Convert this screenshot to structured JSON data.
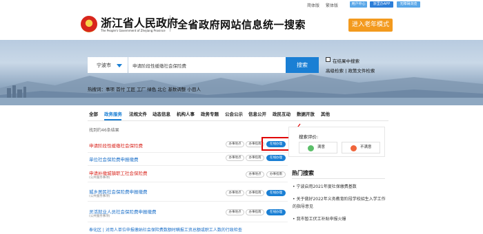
{
  "topbar": {
    "simplified": "简体版",
    "traditional": "繁体版",
    "user_center": "用户中心",
    "app": "浙里办APP",
    "accessible": "无障碍浏览"
  },
  "header": {
    "logo_cn": "浙江省人民政府",
    "logo_en": "The People's Government of Zhejiang Province",
    "slogan": "全省政府网站信息统一搜索",
    "elder_mode": "进入老年模式"
  },
  "search": {
    "region": "宁波市",
    "query": "申请阶段性缓缴社会保险费",
    "button": "搜索",
    "in_results": "在结果中搜索",
    "advanced": "高级检索 | 政策文件检索",
    "hot_words": "热搜词：事项 首付 工匠 工厂 绿色 北仑 基数调整 小目人"
  },
  "tabs": [
    "全部",
    "政务服务",
    "法规文件",
    "动态信息",
    "机构人事",
    "政务专题",
    "公会公示",
    "信息公开",
    "政民互动",
    "数据开放",
    "其他"
  ],
  "active_tab": "政务服务",
  "result_count": "找到约46条结果",
  "results": [
    {
      "title": "申请阶段性缓缴社会保险费",
      "color": "#d9251d",
      "sub": "",
      "buttons": [
        "办事地点",
        "办事指南"
      ],
      "online": "在线办理"
    },
    {
      "title": "单位社会保险费申报缴费",
      "color": "#1a6fc9",
      "sub": "",
      "buttons": [
        "办事地点",
        "办事指南"
      ],
      "online": "在线办理"
    },
    {
      "title": "申请补缴城镇职工社会保险费",
      "color": "#d9251d",
      "sub": "(公共服务事项)",
      "buttons": [
        "办事地点",
        "办事指南"
      ],
      "online": ""
    },
    {
      "title": "城乡居民社会保险费申报缴费",
      "color": "#1a6fc9",
      "sub": "(公共服务事项)",
      "buttons": [
        "办事地点",
        "办事指南"
      ],
      "online": "在线办理"
    },
    {
      "title": "灵活就业人员社会保险费申报缴费",
      "color": "#1a6fc9",
      "sub": "(公共服务事项)",
      "buttons": [
        "办事地点",
        "办事指南"
      ],
      "online": "在线办理"
    },
    {
      "title": "奉化区 | 对用人单位申报缴纳社会保险费数额时瞒报工资总额或职工人数的行政检查",
      "color": "#1a6fc9",
      "sub": "",
      "buttons": [],
      "online": ""
    }
  ],
  "evaluation": {
    "title": "搜索评价:",
    "satisfied": "满意",
    "unsatisfied": "不满意"
  },
  "hot_search": {
    "title": "热门搜索",
    "items": [
      "宁波启用2021年度社保缴费基数",
      "关于做好2022年义务教育阶段学校招生入学工作的指导意见",
      "我市暂工伏工补贴申报火爆"
    ]
  },
  "colors": {
    "accent": "#1a7fd4",
    "orange": "#f39a1e",
    "highlight": "#e00000"
  }
}
